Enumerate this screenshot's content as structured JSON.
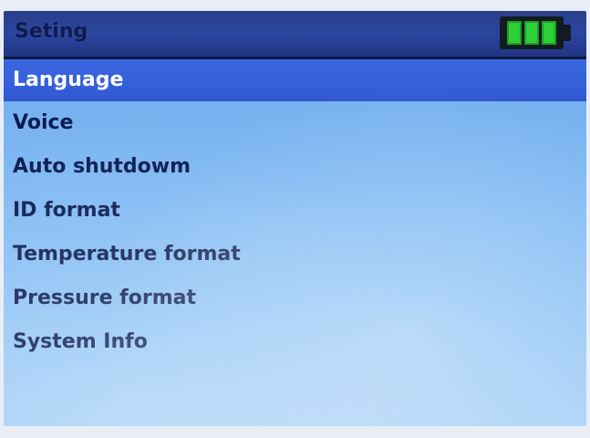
{
  "header": {
    "title": "Seting",
    "battery": {
      "icon": "battery-full-icon",
      "cells": 3,
      "level": 1.0,
      "color": "#2fcf38"
    }
  },
  "menu": {
    "selected_index": 0,
    "items": [
      {
        "label": "Language"
      },
      {
        "label": "Voice"
      },
      {
        "label": "Auto shutdowm"
      },
      {
        "label": "ID format"
      },
      {
        "label": "Temperature format"
      },
      {
        "label": "Pressure format"
      },
      {
        "label": "System Info"
      }
    ]
  },
  "colors": {
    "title_bar": "#2b45a0",
    "selection": "#3560dc",
    "screen_bg": "#7cb6f2",
    "text": "#0b1c52"
  }
}
